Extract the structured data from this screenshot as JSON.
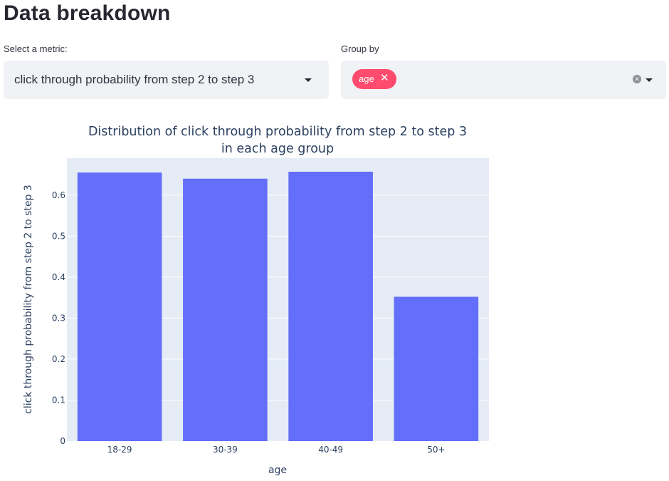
{
  "page": {
    "title": "Data breakdown"
  },
  "metric_select": {
    "label": "Select a metric:",
    "value": "click through probability from step 2 to step 3"
  },
  "groupby_select": {
    "label": "Group by",
    "tags": [
      "age"
    ],
    "tag_remove_icon": "close-icon",
    "clear_icon": "clear-circle-icon",
    "dropdown_icon": "caret-down-icon"
  },
  "colors": {
    "bar": "#636efa",
    "plot_bg": "#e5ecf6",
    "tag_bg": "#ff4b6e",
    "select_bg": "#f0f2f6"
  },
  "chart_data": {
    "type": "bar",
    "title_lines": [
      "Distribution of click through probability from step 2 to step 3",
      "in each age group"
    ],
    "xlabel": "age",
    "ylabel": "click through probability from step 2 to step 3",
    "categories": [
      "18-29",
      "30-39",
      "40-49",
      "50+"
    ],
    "values": [
      0.655,
      0.64,
      0.657,
      0.352
    ],
    "ylim": [
      0,
      0.69
    ],
    "yticks": [
      0,
      0.1,
      0.2,
      0.3,
      0.4,
      0.5,
      0.6
    ],
    "ytick_labels": [
      "0",
      "0.1",
      "0.2",
      "0.3",
      "0.4",
      "0.5",
      "0.6"
    ],
    "grid": true,
    "legend": false
  }
}
